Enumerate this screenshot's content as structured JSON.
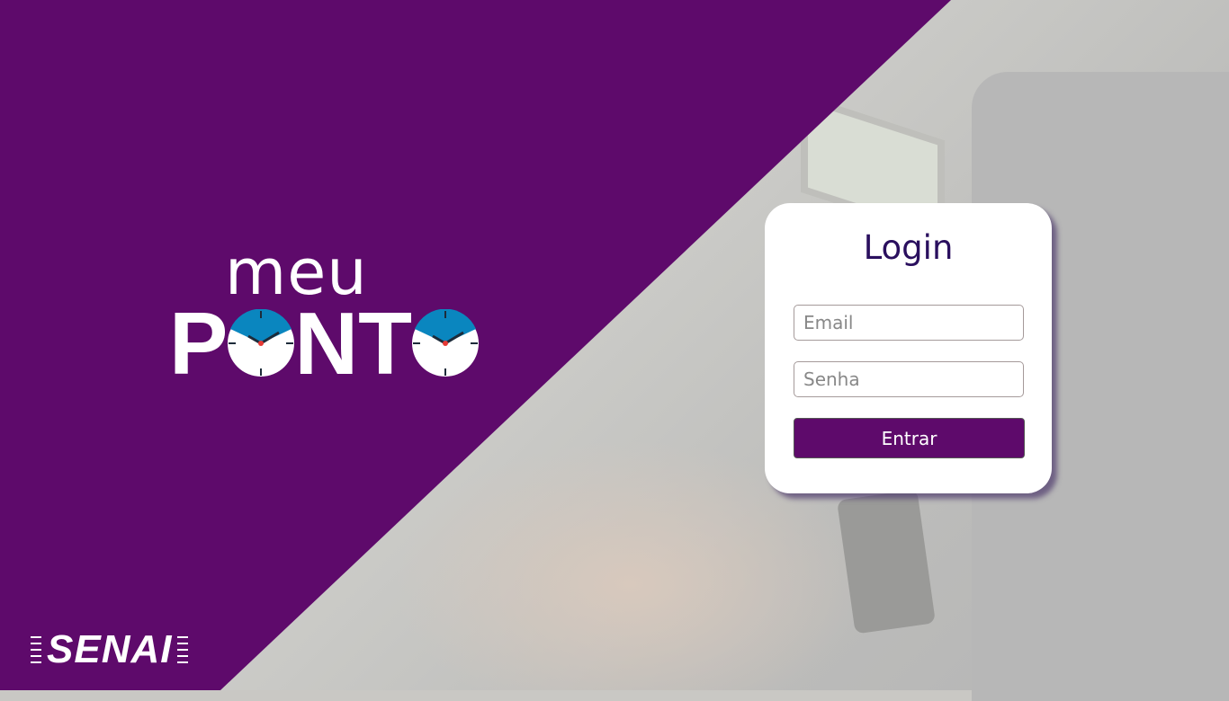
{
  "logo": {
    "line1": "meu",
    "line2_parts": [
      "P",
      "NT"
    ]
  },
  "brand": {
    "name": "SENAI"
  },
  "login": {
    "title": "Login",
    "email_placeholder": "Email",
    "password_placeholder": "Senha",
    "submit_label": "Entrar"
  },
  "colors": {
    "primary": "#5e0a6b",
    "title": "#2a0f5e",
    "clock_blue": "#0a86bf"
  }
}
